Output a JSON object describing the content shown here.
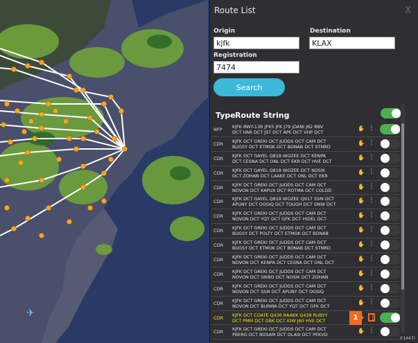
{
  "panel": {
    "title": "Route List",
    "close": "X"
  },
  "form": {
    "origin_label": "Origin",
    "origin_value": "kjfk",
    "destination_label": "Destination",
    "destination_value": "KLAX",
    "registration_label": "Registration",
    "registration_value": "7474",
    "search_label": "Search"
  },
  "list_header": {
    "type": "Type",
    "route": "Route String",
    "toggle_on": true
  },
  "rows": [
    {
      "type": "NFP",
      "line1": "KJFK RWY-13R JFK5 JFK J79 JOANI J62 RBV",
      "line2": "DCT HAR DCT JST DCT APE DCT VHP DCT",
      "on": true,
      "hl": false
    },
    {
      "type": "CDR",
      "line1": "KJFK DCT GREKI DCT JUDDS DCT CAM DCT",
      "line2": "BUGSY DCT ETMOK DCT BONAB DCT STNRD",
      "on": false,
      "hl": false
    },
    {
      "type": "CDR",
      "line1": "KJFK DCT GAYEL Q818 WOZEE DCT KENPA",
      "line2": "DCT CESNA DCT ONL DCT EKR DCT HVE DCT",
      "on": false,
      "hl": false
    },
    {
      "type": "CDR",
      "line1": "KJFK DCT GAYEL Q818 WOZEE DCT NOSIK",
      "line2": "DCT ZOHAN DCT LAAKE DCT ONL DCT EKR",
      "on": false,
      "hl": false
    },
    {
      "type": "CDR",
      "line1": "KJFK DCT GREKI DCT JUDDS DCT CAM DCT",
      "line2": "NOVON DCT KAPUX DCT ROTMA DCT COLDD",
      "on": false,
      "hl": false
    },
    {
      "type": "CDR",
      "line1": "KJFK DCT GAYEL Q818 WOZEE Q917 SSM DCT",
      "line2": "APUNY DCT OGSIQ DCT TOUGH DCT DNW DCT",
      "on": false,
      "hl": false
    },
    {
      "type": "CDR",
      "line1": "KJFK DCT GREKI DCT JUDDS DCT CAM DCT",
      "line2": "NOVON DCT YQT DCT GFK DCT HIDEL DCT",
      "on": false,
      "hl": false
    },
    {
      "type": "CDR",
      "line1": "KJFK DCT GREKI DCT JUDDS DCT CAM DCT",
      "line2": "BUGSY DCT POLTY DCT ETMOK DCT BONAB",
      "on": false,
      "hl": false
    },
    {
      "type": "CDR",
      "line1": "KJFK DCT GREKI DCT JUDDS DCT CAM DCT",
      "line2": "BUGSY DCT ETMOK DCT BONAB DCT STNRD",
      "on": false,
      "hl": false
    },
    {
      "type": "CDR",
      "line1": "KJFK DCT GREKI DCT JUDDS DCT CAM DCT",
      "line2": "NOVON DCT KENPA DCT CESNA DCT ONL DCT",
      "on": false,
      "hl": false
    },
    {
      "type": "CDR",
      "line1": "KJFK DCT GREKI DCT JUDDS DCT CAM DCT",
      "line2": "NOVON DCT SIKBO DCT NOSIK DCT ZOHAN",
      "on": false,
      "hl": false
    },
    {
      "type": "CDR",
      "line1": "KJFK DCT GREKI DCT JUDDS DCT CAM DCT",
      "line2": "NOVON DCT SSM DCT APUNY DCT OGSIQ",
      "on": false,
      "hl": false
    },
    {
      "type": "CDR",
      "line1": "KJFK DCT GREKI DCT JUDDS DCT CAM DCT",
      "line2": "NOVON DCT BURWA DCT YQT DCT GFK DCT",
      "on": false,
      "hl": false
    },
    {
      "type": "CDR",
      "line1": "KJFK DCT COATE Q436 RAAKK Q438 RUBYY",
      "line2": "DCT PMM DCT OBK DCT IOW J60 HVE DCT",
      "on": true,
      "hl": true
    },
    {
      "type": "CDR",
      "line1": "KJFK DCT GREKI DCT JUDDS DCT CAM DCT",
      "line2": "PBERG DCT BOSAM DCT OLASI DCT PEKVO",
      "on": false,
      "hl": false
    }
  ],
  "badge": "1",
  "version": "(r1447)",
  "colors": {
    "accent": "#3cb9d8",
    "toggle_on": "#4caf50",
    "highlight": "#ffe600",
    "badge": "#f26b21"
  },
  "icons": {
    "hand": "hand-icon",
    "dots": "more-vertical-icon",
    "plane": "airplane-icon"
  }
}
